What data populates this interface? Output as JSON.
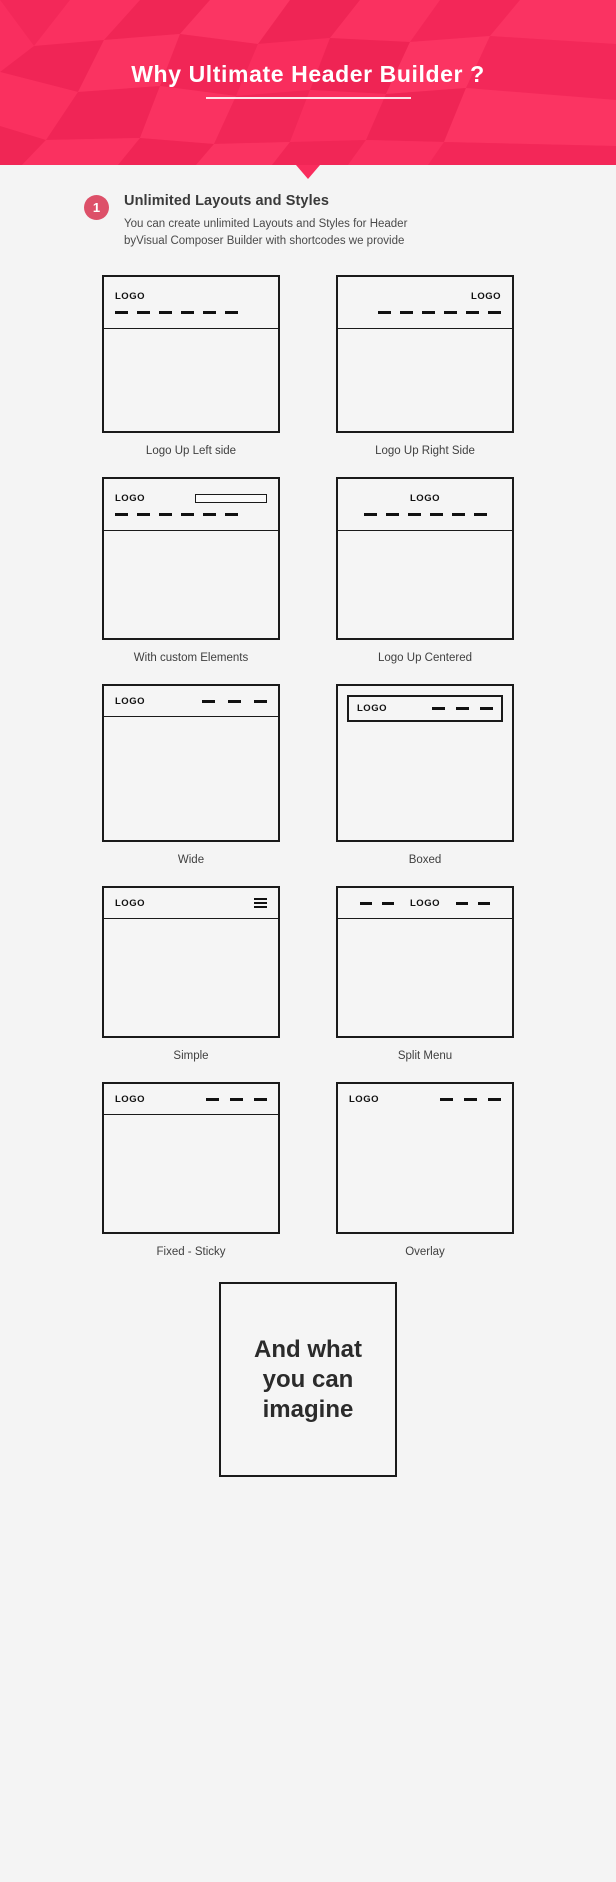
{
  "banner": {
    "title": "Why Ultimate Header Builder ?",
    "accent_color": "#f92c5d"
  },
  "feature": {
    "number": "1",
    "badge_color": "#dd5069",
    "title": "Unlimited Layouts and Styles",
    "description": "You can create unlimited Layouts and Styles for Header byVisual Composer Builder with shortcodes we provide"
  },
  "logo_label": "LOGO",
  "mockups": [
    [
      {
        "caption": "Logo Up Left side",
        "logo_align": "left",
        "menu_dashes": 6,
        "variant": "stacked"
      },
      {
        "caption": "Logo Up Right Side",
        "logo_align": "right",
        "menu_dashes": 6,
        "variant": "stacked"
      }
    ],
    [
      {
        "caption": "With custom Elements",
        "logo_align": "left",
        "menu_dashes": 6,
        "variant": "stacked-element"
      },
      {
        "caption": "Logo Up Centered",
        "logo_align": "center",
        "menu_dashes": 6,
        "variant": "stacked"
      }
    ],
    [
      {
        "caption": "Wide",
        "logo_align": "left",
        "menu_dashes": 3,
        "variant": "inline"
      },
      {
        "caption": "Boxed",
        "logo_align": "left",
        "menu_dashes": 3,
        "variant": "boxed"
      }
    ],
    [
      {
        "caption": "Simple",
        "logo_align": "left",
        "menu_dashes": 0,
        "variant": "hamburger"
      },
      {
        "caption": "Split Menu",
        "logo_align": "center",
        "menu_dashes": 4,
        "variant": "split"
      }
    ],
    [
      {
        "caption": "Fixed - Sticky",
        "logo_align": "left",
        "menu_dashes": 3,
        "variant": "inline"
      },
      {
        "caption": "Overlay",
        "logo_align": "left",
        "menu_dashes": 3,
        "variant": "inline"
      }
    ]
  ],
  "final_card": {
    "text": "And what you can imagine"
  }
}
